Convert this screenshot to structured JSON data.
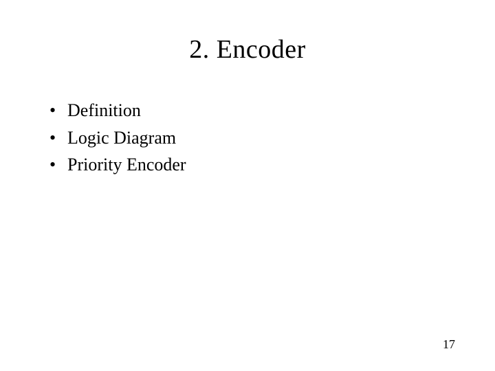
{
  "title": "2. Encoder",
  "bullets": {
    "0": "Definition",
    "1": "Logic Diagram",
    "2": "Priority Encoder"
  },
  "page_number": "17"
}
